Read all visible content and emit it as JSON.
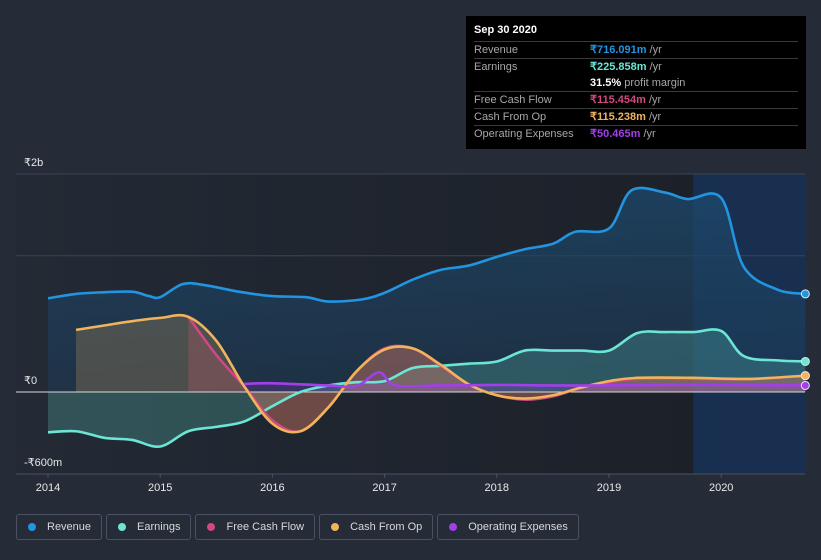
{
  "tooltip": {
    "date": "Sep 30 2020",
    "rows": [
      {
        "label": "Revenue",
        "value": "₹716.091m",
        "unit": " /yr",
        "color": "#2394df"
      },
      {
        "label": "Earnings",
        "value": "₹225.858m",
        "unit": " /yr",
        "color": "#6ce5d4"
      },
      {
        "label": "",
        "value": "31.5%",
        "unit": " profit margin",
        "color": "#ffffff"
      },
      {
        "label": "Free Cash Flow",
        "value": "₹115.454m",
        "unit": " /yr",
        "color": "#d0487f"
      },
      {
        "label": "Cash From Op",
        "value": "₹115.238m",
        "unit": " /yr",
        "color": "#f1b35c"
      },
      {
        "label": "Operating Expenses",
        "value": "₹50.465m",
        "unit": " /yr",
        "color": "#a23fe8"
      }
    ]
  },
  "legend": [
    {
      "label": "Revenue",
      "color": "#2394df"
    },
    {
      "label": "Earnings",
      "color": "#6ce5d4"
    },
    {
      "label": "Free Cash Flow",
      "color": "#d0487f"
    },
    {
      "label": "Cash From Op",
      "color": "#f1b35c"
    },
    {
      "label": "Operating Expenses",
      "color": "#a23fe8"
    }
  ],
  "chart_data": {
    "type": "area",
    "title": "",
    "xlabel": "",
    "ylabel": "",
    "y_tick_labels": [
      {
        "value": 2000,
        "label": "₹2b"
      },
      {
        "value": 0,
        "label": "₹0"
      },
      {
        "value": -600,
        "label": "-₹600m"
      }
    ],
    "ylim": [
      -750,
      2000
    ],
    "y_units": "₹ millions",
    "x_tick_labels": [
      "2014",
      "2015",
      "2016",
      "2017",
      "2018",
      "2019",
      "2020"
    ],
    "xlim": [
      2013.7,
      2020.75
    ],
    "grid": true,
    "highlight_region": {
      "from": 2019.75,
      "to": 2020.75
    },
    "series": [
      {
        "name": "Revenue",
        "color": "#2394df",
        "points": [
          [
            2014.0,
            860
          ],
          [
            2014.25,
            900
          ],
          [
            2014.5,
            915
          ],
          [
            2014.75,
            920
          ],
          [
            2014.9,
            880
          ],
          [
            2015.0,
            870
          ],
          [
            2015.2,
            990
          ],
          [
            2015.4,
            980
          ],
          [
            2015.7,
            920
          ],
          [
            2016.0,
            880
          ],
          [
            2016.3,
            870
          ],
          [
            2016.5,
            830
          ],
          [
            2016.8,
            850
          ],
          [
            2017.0,
            910
          ],
          [
            2017.25,
            1030
          ],
          [
            2017.5,
            1120
          ],
          [
            2017.75,
            1160
          ],
          [
            2018.0,
            1240
          ],
          [
            2018.25,
            1310
          ],
          [
            2018.5,
            1360
          ],
          [
            2018.7,
            1470
          ],
          [
            2019.0,
            1500
          ],
          [
            2019.2,
            1850
          ],
          [
            2019.5,
            1830
          ],
          [
            2019.7,
            1770
          ],
          [
            2020.0,
            1780
          ],
          [
            2020.2,
            1150
          ],
          [
            2020.5,
            940
          ],
          [
            2020.75,
            900
          ]
        ]
      },
      {
        "name": "Earnings",
        "color": "#6ce5d4",
        "points": [
          [
            2014.0,
            -370
          ],
          [
            2014.25,
            -360
          ],
          [
            2014.5,
            -420
          ],
          [
            2014.75,
            -440
          ],
          [
            2015.0,
            -500
          ],
          [
            2015.25,
            -360
          ],
          [
            2015.5,
            -320
          ],
          [
            2015.75,
            -270
          ],
          [
            2016.0,
            -130
          ],
          [
            2016.25,
            0
          ],
          [
            2016.5,
            60
          ],
          [
            2016.75,
            90
          ],
          [
            2017.0,
            100
          ],
          [
            2017.25,
            220
          ],
          [
            2017.5,
            240
          ],
          [
            2017.75,
            260
          ],
          [
            2018.0,
            280
          ],
          [
            2018.25,
            380
          ],
          [
            2018.5,
            380
          ],
          [
            2018.75,
            380
          ],
          [
            2019.0,
            380
          ],
          [
            2019.25,
            540
          ],
          [
            2019.5,
            550
          ],
          [
            2019.75,
            550
          ],
          [
            2020.0,
            560
          ],
          [
            2020.2,
            330
          ],
          [
            2020.5,
            290
          ],
          [
            2020.75,
            280
          ]
        ]
      },
      {
        "name": "Free Cash Flow",
        "color": "#d0487f",
        "points": [
          [
            2015.25,
            690
          ],
          [
            2015.5,
            340
          ],
          [
            2015.75,
            50
          ],
          [
            2016.0,
            -260
          ],
          [
            2016.25,
            -360
          ],
          [
            2016.5,
            -140
          ],
          [
            2016.75,
            190
          ],
          [
            2017.0,
            400
          ],
          [
            2017.25,
            400
          ],
          [
            2017.5,
            240
          ],
          [
            2017.75,
            70
          ],
          [
            2018.0,
            -30
          ],
          [
            2018.25,
            -70
          ],
          [
            2018.5,
            -40
          ],
          [
            2018.75,
            40
          ],
          [
            2019.0,
            90
          ],
          [
            2019.25,
            120
          ],
          [
            2019.75,
            120
          ],
          [
            2020.25,
            120
          ],
          [
            2020.75,
            150
          ]
        ]
      },
      {
        "name": "Cash From Op",
        "color": "#f1b35c",
        "points": [
          [
            2014.25,
            570
          ],
          [
            2014.5,
            610
          ],
          [
            2014.75,
            650
          ],
          [
            2015.0,
            680
          ],
          [
            2015.25,
            690
          ],
          [
            2015.5,
            470
          ],
          [
            2015.75,
            50
          ],
          [
            2016.0,
            -290
          ],
          [
            2016.25,
            -360
          ],
          [
            2016.5,
            -140
          ],
          [
            2016.75,
            190
          ],
          [
            2017.0,
            390
          ],
          [
            2017.25,
            400
          ],
          [
            2017.5,
            250
          ],
          [
            2017.75,
            70
          ],
          [
            2018.0,
            -30
          ],
          [
            2018.25,
            -60
          ],
          [
            2018.5,
            -30
          ],
          [
            2018.75,
            40
          ],
          [
            2019.0,
            100
          ],
          [
            2019.25,
            130
          ],
          [
            2019.75,
            130
          ],
          [
            2020.25,
            120
          ],
          [
            2020.75,
            150
          ]
        ]
      },
      {
        "name": "Operating Expenses",
        "color": "#a23fe8",
        "points": [
          [
            2015.75,
            75
          ],
          [
            2016.0,
            80
          ],
          [
            2016.5,
            60
          ],
          [
            2016.75,
            55
          ],
          [
            2016.95,
            180
          ],
          [
            2017.1,
            60
          ],
          [
            2017.5,
            60
          ],
          [
            2018.0,
            65
          ],
          [
            2018.5,
            60
          ],
          [
            2019.0,
            60
          ],
          [
            2019.5,
            65
          ],
          [
            2020.0,
            65
          ],
          [
            2020.75,
            60
          ]
        ]
      }
    ]
  }
}
